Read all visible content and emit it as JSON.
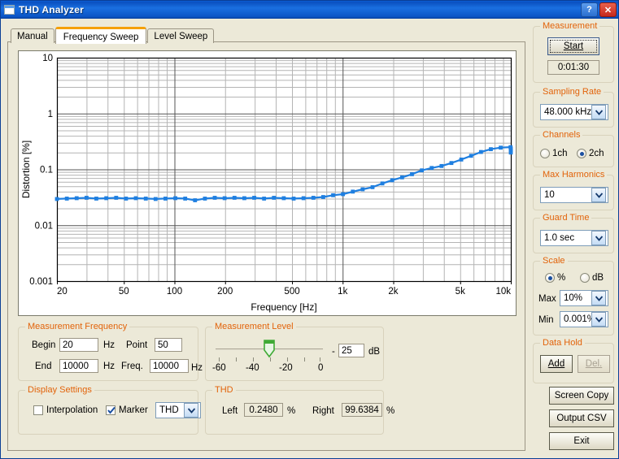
{
  "window": {
    "title": "THD Analyzer",
    "icon": "application-window-icon",
    "help_label": "?",
    "close_label": "✕"
  },
  "tabs": [
    {
      "label": "Manual",
      "active": false
    },
    {
      "label": "Frequency Sweep",
      "active": true
    },
    {
      "label": "Level Sweep",
      "active": false
    }
  ],
  "chart_data": {
    "type": "line",
    "title": "",
    "xlabel": "Frequency [Hz]",
    "ylabel": "Distortion [%]",
    "xscale": "log",
    "yscale": "log",
    "xlim": [
      20,
      10000
    ],
    "ylim": [
      0.001,
      10
    ],
    "xticks": [
      20,
      50,
      100,
      200,
      500,
      1000,
      2000,
      5000,
      10000
    ],
    "xticklabels": [
      "20",
      "50",
      "100",
      "200",
      "500",
      "1k",
      "2k",
      "5k",
      "10k"
    ],
    "yticks": [
      0.001,
      0.01,
      0.1,
      1,
      10
    ],
    "yticklabels": [
      "0.001",
      "0.01",
      "0.1",
      "1",
      "10"
    ],
    "grid": true,
    "legend": "none",
    "series": [
      {
        "name": "THD",
        "color": "#1f7fe0",
        "marker": "square",
        "x": [
          20,
          22.9,
          26.2,
          30.0,
          34.3,
          39.3,
          45.0,
          51.5,
          58.9,
          67.5,
          77.2,
          88.4,
          101.2,
          115.8,
          132.5,
          151.7,
          173.6,
          198.7,
          227.4,
          260.3,
          297.9,
          341.0,
          390.3,
          446.7,
          511.3,
          585.2,
          669.8,
          766.6,
          877.4,
          1004.2,
          1149.4,
          1315.5,
          1505.6,
          1723.2,
          1972.3,
          2257.3,
          2583.5,
          2956.9,
          3384.3,
          3873.5,
          4433.3,
          5074.0,
          5807.4,
          6646.9,
          7607.9,
          8707.8,
          9966.0,
          10000,
          10000,
          10000
        ],
        "y": [
          0.0295,
          0.03,
          0.0305,
          0.031,
          0.03,
          0.0305,
          0.031,
          0.03,
          0.0305,
          0.03,
          0.0295,
          0.03,
          0.0305,
          0.03,
          0.028,
          0.03,
          0.031,
          0.0305,
          0.031,
          0.0305,
          0.031,
          0.03,
          0.031,
          0.0305,
          0.03,
          0.0305,
          0.031,
          0.032,
          0.0345,
          0.036,
          0.04,
          0.044,
          0.048,
          0.056,
          0.064,
          0.072,
          0.082,
          0.096,
          0.106,
          0.115,
          0.13,
          0.15,
          0.175,
          0.205,
          0.23,
          0.245,
          0.25,
          0.215,
          0.2,
          0.235
        ]
      }
    ]
  },
  "measurement_frequency": {
    "legend": "Measurement Frequency",
    "begin_label": "Begin",
    "begin_value": "20",
    "begin_unit": "Hz",
    "point_label": "Point",
    "point_value": "50",
    "end_label": "End",
    "end_value": "10000",
    "end_unit": "Hz",
    "freq_label": "Freq.",
    "freq_value": "10000",
    "freq_unit": "Hz"
  },
  "measurement_level": {
    "legend": "Measurement Level",
    "ticks": [
      "-60",
      "-40",
      "-20",
      "0"
    ],
    "slider_value": -25,
    "slider_min": -60,
    "slider_max": 0,
    "sign": "-",
    "value": "25",
    "unit": "dB"
  },
  "display_settings": {
    "legend": "Display Settings",
    "interpolation_label": "Interpolation",
    "interpolation_checked": false,
    "marker_label": "Marker",
    "marker_checked": true,
    "mode_value": "THD"
  },
  "thd": {
    "legend": "THD",
    "left_label": "Left",
    "left_value": "0.2480",
    "left_unit": "%",
    "right_label": "Right",
    "right_value": "99.6384",
    "right_unit": "%"
  },
  "sidebar": {
    "measurement": {
      "legend": "Measurement",
      "start_label": "Start",
      "elapsed": "0:01:30"
    },
    "sampling_rate": {
      "legend": "Sampling Rate",
      "value": "48.000 kHz"
    },
    "channels": {
      "legend": "Channels",
      "options": [
        "1ch",
        "2ch"
      ],
      "selected": "2ch"
    },
    "max_harmonics": {
      "legend": "Max Harmonics",
      "value": "10"
    },
    "guard_time": {
      "legend": "Guard Time",
      "value": "1.0 sec"
    },
    "scale": {
      "legend": "Scale",
      "options": [
        "%",
        "dB"
      ],
      "selected": "%",
      "max_label": "Max",
      "max_value": "10%",
      "min_label": "Min",
      "min_value": "0.001%"
    },
    "data_hold": {
      "legend": "Data Hold",
      "add_label": "Add",
      "del_label": "Del.",
      "del_disabled": true
    },
    "actions": {
      "screen_copy": "Screen Copy",
      "output_csv": "Output CSV",
      "exit": "Exit"
    }
  },
  "colors": {
    "accent_orange": "#e2630a",
    "trace_blue": "#1f7fe0",
    "title_blue": "#0b5ed7",
    "slider_green": "#3faa35"
  }
}
